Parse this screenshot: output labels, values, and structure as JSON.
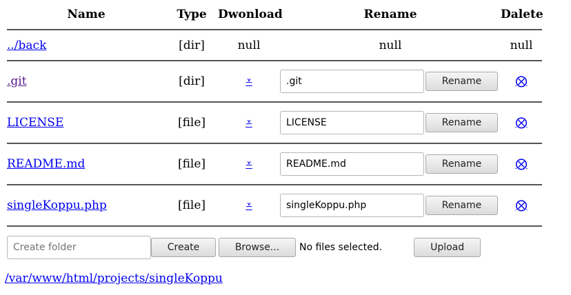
{
  "headers": {
    "name": "Name",
    "type": "Type",
    "download": "Dwonload",
    "rename": "Rename",
    "delete": "Dalete"
  },
  "back_row": {
    "name": "../back",
    "type": "[dir]",
    "download": "null",
    "rename": "null",
    "delete": "null"
  },
  "rows": [
    {
      "name": ".git",
      "type": "[dir]",
      "download_icon": "⩡",
      "rename_value": ".git",
      "rename_button": "Rename",
      "delete_icon": "⨂"
    },
    {
      "name": "LICENSE",
      "type": "[file]",
      "download_icon": "⩡",
      "rename_value": "LICENSE",
      "rename_button": "Rename",
      "delete_icon": "⨂"
    },
    {
      "name": "README.md",
      "type": "[file]",
      "download_icon": "⩡",
      "rename_value": "README.md",
      "rename_button": "Rename",
      "delete_icon": "⨂"
    },
    {
      "name": "singleKoppu.php",
      "type": "[file]",
      "download_icon": "⩡",
      "rename_value": "singleKoppu.php",
      "rename_button": "Rename",
      "delete_icon": "⨂"
    }
  ],
  "bottom": {
    "folder_placeholder": "Create folder",
    "create_label": "Create",
    "browse_label": "Browse...",
    "file_status": "No files selected.",
    "upload_label": "Upload"
  },
  "path": "/var/www/html/projects/singleKoppu",
  "colors": {
    "link": "#0000ee",
    "visited_link": "#551a8b",
    "divider": "#555555"
  }
}
